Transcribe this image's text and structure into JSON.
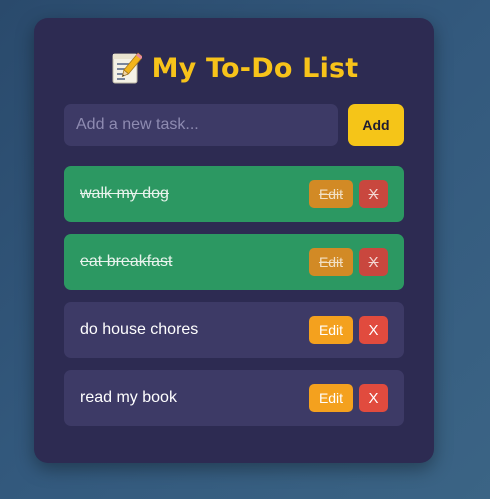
{
  "app": {
    "title": "My To-Do List",
    "title_icon": "memo-icon",
    "accent_color": "#f5c518"
  },
  "input": {
    "placeholder": "Add a new task...",
    "value": "",
    "add_label": "Add"
  },
  "tasks": [
    {
      "text": "walk my dog",
      "completed": true,
      "edit_label": "Edit",
      "delete_label": "X"
    },
    {
      "text": "eat breakfast",
      "completed": true,
      "edit_label": "Edit",
      "delete_label": "X"
    },
    {
      "text": "do house chores",
      "completed": false,
      "edit_label": "Edit",
      "delete_label": "X"
    },
    {
      "text": "read my book",
      "completed": false,
      "edit_label": "Edit",
      "delete_label": "X"
    }
  ],
  "colors": {
    "card_bg": "#2d2b52",
    "completed_bg": "#2c9862",
    "pending_bg": "#3d3a66",
    "edit_button": "#f4a11e",
    "delete_button": "#e14b3e"
  }
}
